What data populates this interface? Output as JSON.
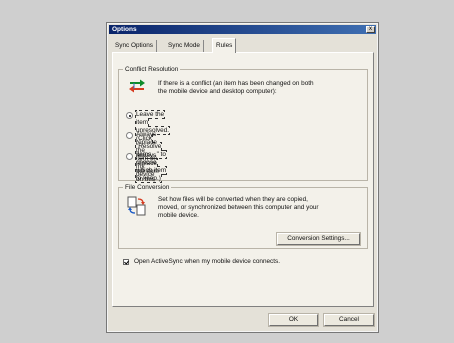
{
  "window": {
    "title": "Options",
    "close_glyph": "x"
  },
  "tabs": [
    {
      "label": "Sync Options"
    },
    {
      "label": "Sync Mode"
    },
    {
      "label": "Rules"
    }
  ],
  "conflict_resolution": {
    "label": "Conflict Resolution",
    "icon": "sync-arrows-icon",
    "description_line1": "If there is a conflict (an item has been changed on both",
    "description_line2": "the mobile device and desktop computer):",
    "options": [
      {
        "line1": "Leave the item unresolved. (Click \"Resolve items...\" to",
        "line2": "choose which item to keep.)",
        "checked": true
      },
      {
        "line1": "Always replace the item on my device",
        "checked": false
      },
      {
        "line1": "Always replace the item on this computer",
        "checked": false
      }
    ]
  },
  "file_conversion": {
    "label": "File Conversion",
    "icon": "file-conversion-icon",
    "description_line1": "Set how files will be converted when they are copied,",
    "description_line2": "moved, or synchronized between this computer and your",
    "description_line3": "mobile device.",
    "button_label": "Conversion Settings..."
  },
  "open_activesync": {
    "label": "Open ActiveSync when my mobile device connects.",
    "checked": true
  },
  "footer": {
    "ok_label": "OK",
    "cancel_label": "Cancel"
  }
}
